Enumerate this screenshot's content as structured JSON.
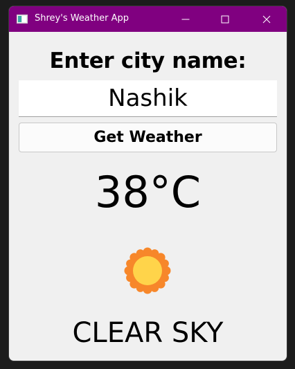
{
  "window": {
    "title": "Shrey's Weather App",
    "titlebar_color": "#800080"
  },
  "form": {
    "prompt_label": "Enter city name:",
    "city_value": "Nashik",
    "button_label": "Get Weather"
  },
  "result": {
    "temperature": "38°C",
    "condition_icon": "sun-icon",
    "description": "CLEAR SKY"
  }
}
